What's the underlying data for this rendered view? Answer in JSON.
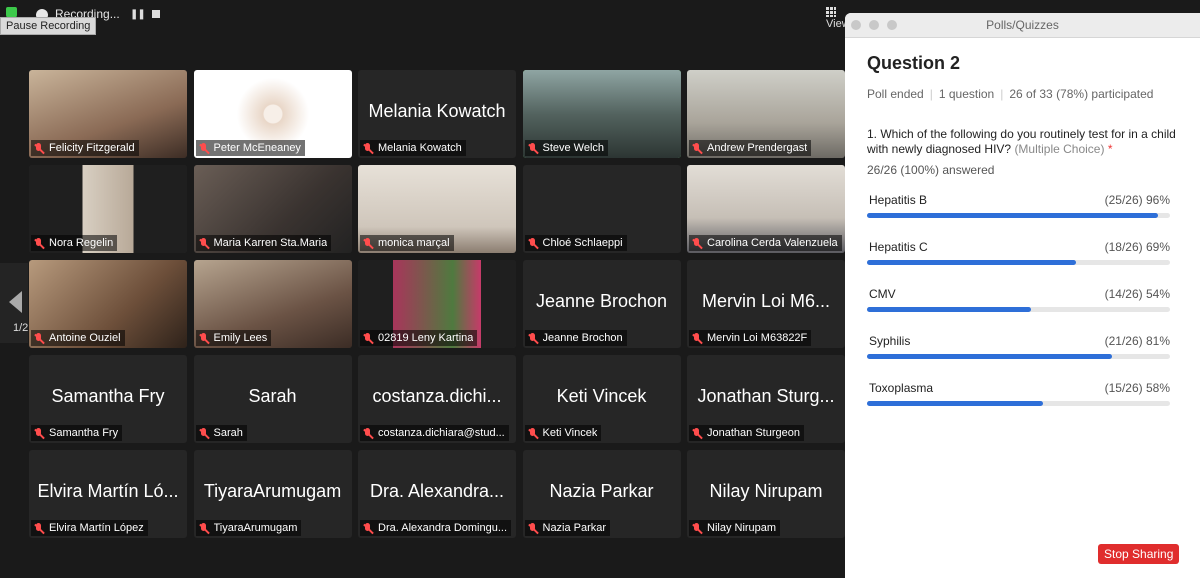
{
  "topbar": {
    "recording_label": "Recording...",
    "pause_tooltip": "Pause Recording",
    "view_label": "View"
  },
  "gallery": {
    "page_indicator": "1/2",
    "tiles": [
      {
        "name": "Felicity Fitzgerald",
        "big": "",
        "video": true,
        "active": false
      },
      {
        "name": "Peter McEneaney",
        "big": "",
        "video": true,
        "active": false
      },
      {
        "name": "Melania Kowatch",
        "big": "Melania Kowatch",
        "video": false,
        "active": false
      },
      {
        "name": "Steve Welch",
        "big": "",
        "video": true,
        "active": true
      },
      {
        "name": "Andrew Prendergast",
        "big": "",
        "video": true,
        "active": false
      },
      {
        "name": "Nora Regelin",
        "big": "",
        "video": true,
        "active": false
      },
      {
        "name": "Maria Karren Sta.Maria",
        "big": "",
        "video": true,
        "active": false
      },
      {
        "name": "monica marçal",
        "big": "",
        "video": true,
        "active": false
      },
      {
        "name": "Chloé Schlaeppi",
        "big": "",
        "video": false,
        "active": false
      },
      {
        "name": "Carolina Cerda Valenzuela",
        "big": "",
        "video": true,
        "active": false
      },
      {
        "name": "Antoine Ouziel",
        "big": "",
        "video": true,
        "active": false
      },
      {
        "name": "Emily Lees",
        "big": "",
        "video": true,
        "active": false
      },
      {
        "name": "02819 Leny Kartina",
        "big": "",
        "video": true,
        "active": false
      },
      {
        "name": "Jeanne Brochon",
        "big": "Jeanne Brochon",
        "video": false,
        "active": false
      },
      {
        "name": "Mervin Loi M63822F",
        "big": "Mervin Loi M6...",
        "video": false,
        "active": false
      },
      {
        "name": "Samantha Fry",
        "big": "Samantha Fry",
        "video": false,
        "active": false
      },
      {
        "name": "Sarah",
        "big": "Sarah",
        "video": false,
        "active": false
      },
      {
        "name": "costanza.dichiara@stud...",
        "big": "costanza.dichi...",
        "video": false,
        "active": false
      },
      {
        "name": "Keti Vincek",
        "big": "Keti Vincek",
        "video": false,
        "active": false
      },
      {
        "name": "Jonathan Sturgeon",
        "big": "Jonathan Sturg...",
        "video": false,
        "active": false
      },
      {
        "name": "Elvira Martín López",
        "big": "Elvira Martín Ló...",
        "video": false,
        "active": false
      },
      {
        "name": "TiyaraArumugam",
        "big": "TiyaraArumugam",
        "video": false,
        "active": false
      },
      {
        "name": "Dra. Alexandra Domingu...",
        "big": "Dra. Alexandra...",
        "video": false,
        "active": false
      },
      {
        "name": "Nazia Parkar",
        "big": "Nazia Parkar",
        "video": false,
        "active": false
      },
      {
        "name": "Nilay Nirupam",
        "big": "Nilay Nirupam",
        "video": false,
        "active": false
      }
    ]
  },
  "poll": {
    "window_title": "Polls/Quizzes",
    "heading": "Question 2",
    "status": "Poll ended",
    "question_count": "1 question",
    "participation": "26 of 33 (78%) participated",
    "question_text": "1. Which of the following do you routinely test for in a child with newly diagnosed HIV?",
    "question_type": "(Multiple Choice)",
    "required_mark": "*",
    "answered": "26/26 (100%) answered",
    "options": [
      {
        "label": "Hepatitis B",
        "count": "(25/26) 96%",
        "pct": 96
      },
      {
        "label": "Hepatitis C",
        "count": "(18/26) 69%",
        "pct": 69
      },
      {
        "label": "CMV",
        "count": "(14/26) 54%",
        "pct": 54
      },
      {
        "label": "Syphilis",
        "count": "(21/26) 81%",
        "pct": 81
      },
      {
        "label": "Toxoplasma",
        "count": "(15/26) 58%",
        "pct": 58
      }
    ]
  },
  "stop_sharing_label": "Stop Sharing",
  "colors": {
    "accent_blue": "#2e6fd8",
    "stop_red": "#e02d2d",
    "active_green": "#6dd36d",
    "mute_red": "#ff4d4d"
  }
}
